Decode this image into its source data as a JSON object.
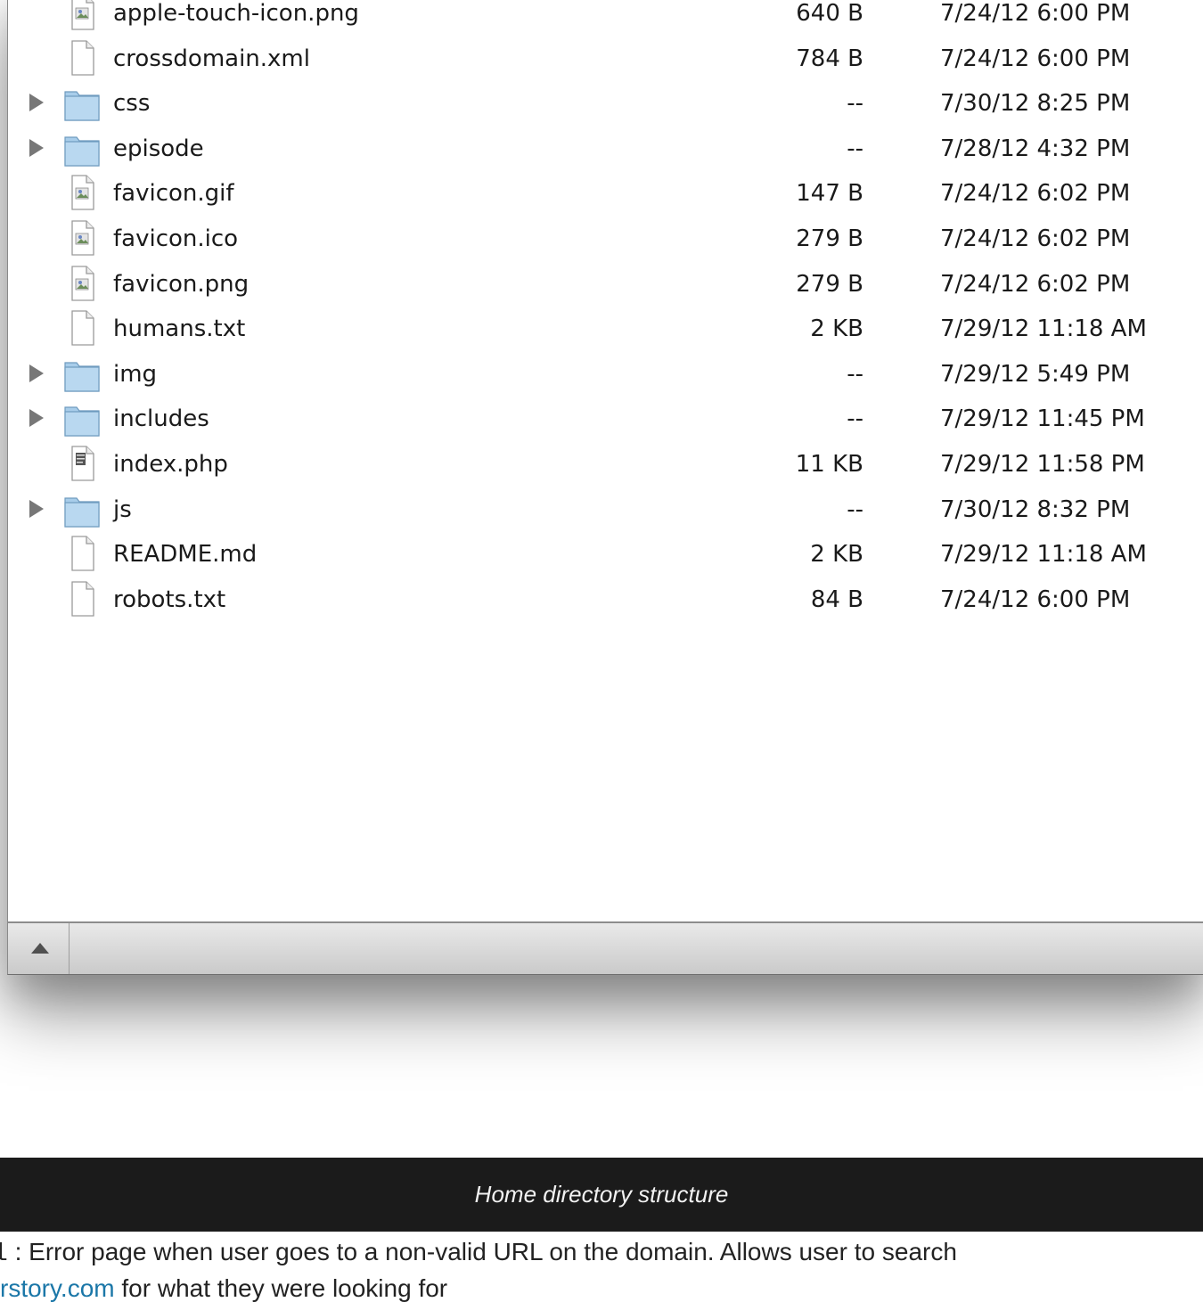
{
  "files": [
    {
      "name": "apple-touch-icon.png",
      "size": "640 B",
      "date": "7/24/12 6:00 PM",
      "kind": "image",
      "icon": "image-file-icon"
    },
    {
      "name": "crossdomain.xml",
      "size": "784 B",
      "date": "7/24/12 6:00 PM",
      "kind": "document",
      "icon": "document-file-icon"
    },
    {
      "name": "css",
      "size": "--",
      "date": "7/30/12 8:25 PM",
      "kind": "folder",
      "icon": "folder-icon"
    },
    {
      "name": "episode",
      "size": "--",
      "date": "7/28/12 4:32 PM",
      "kind": "folder",
      "icon": "folder-icon"
    },
    {
      "name": "favicon.gif",
      "size": "147 B",
      "date": "7/24/12 6:02 PM",
      "kind": "image",
      "icon": "image-file-icon"
    },
    {
      "name": "favicon.ico",
      "size": "279 B",
      "date": "7/24/12 6:02 PM",
      "kind": "image",
      "icon": "image-file-icon"
    },
    {
      "name": "favicon.png",
      "size": "279 B",
      "date": "7/24/12 6:02 PM",
      "kind": "image",
      "icon": "image-file-icon"
    },
    {
      "name": "humans.txt",
      "size": "2 KB",
      "date": "7/29/12 11:18 AM",
      "kind": "document",
      "icon": "document-file-icon"
    },
    {
      "name": "img",
      "size": "--",
      "date": "7/29/12 5:49 PM",
      "kind": "folder",
      "icon": "folder-icon"
    },
    {
      "name": "includes",
      "size": "--",
      "date": "7/29/12 11:45 PM",
      "kind": "folder",
      "icon": "folder-icon"
    },
    {
      "name": "index.php",
      "size": "11 KB",
      "date": "7/29/12 11:58 PM",
      "kind": "php",
      "icon": "php-file-icon"
    },
    {
      "name": "js",
      "size": "--",
      "date": "7/30/12 8:32 PM",
      "kind": "folder",
      "icon": "folder-icon"
    },
    {
      "name": "README.md",
      "size": "2 KB",
      "date": "7/29/12 11:18 AM",
      "kind": "document",
      "icon": "document-file-icon"
    },
    {
      "name": "robots.txt",
      "size": "84 B",
      "date": "7/24/12 6:00 PM",
      "kind": "document",
      "icon": "document-file-icon"
    }
  ],
  "statusbar": {
    "toggle_icon": "triangle-up-icon"
  },
  "caption": "Home directory structure",
  "body": {
    "code_fragment": "l",
    "text_line1": " : Error page when user goes to a non-valid URL on the domain. Allows user to search",
    "link_text": "rstory.com",
    "text_line2": " for what they were looking for"
  },
  "colors": {
    "folder_blue": "#9ec6e6",
    "link": "#1b77a8",
    "caption_bg": "#1b1b1b"
  }
}
